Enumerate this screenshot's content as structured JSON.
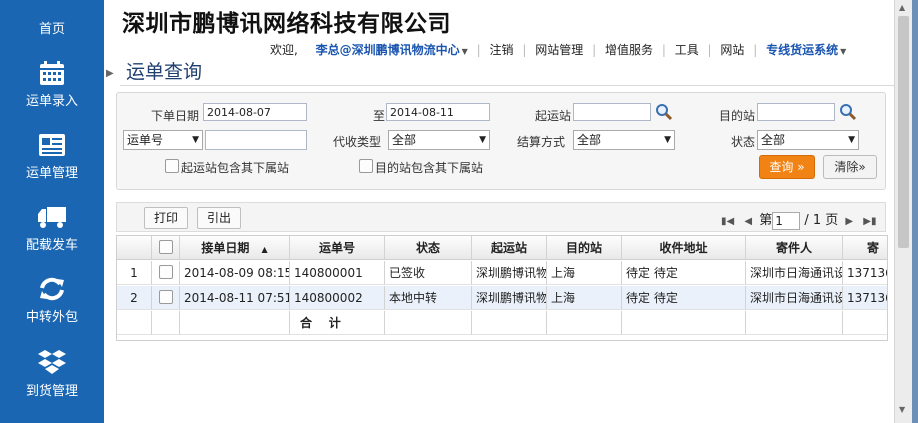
{
  "sidebar": {
    "items": [
      {
        "label": "首页",
        "icon": "home"
      },
      {
        "label": "运单录入",
        "icon": "calendar-icon"
      },
      {
        "label": "运单管理",
        "icon": "document-list-icon"
      },
      {
        "label": "配载发车",
        "icon": "truck-icon"
      },
      {
        "label": "中转外包",
        "icon": "refresh-icon"
      },
      {
        "label": "到货管理",
        "icon": "dropbox-icon"
      }
    ]
  },
  "header": {
    "company": "深圳市鹏博讯网络科技有限公司",
    "welcome": "欢迎,",
    "user": "李总@深圳鹏博讯物流中心",
    "nav": [
      "注销",
      "网站管理",
      "增值服务",
      "工具",
      "网站"
    ],
    "system": "专线货运系统"
  },
  "page_title": "运单查询",
  "filters": {
    "order_date_label": "下单日期",
    "date_from": "2014-08-07",
    "to_label": "至",
    "date_to": "2014-08-11",
    "origin_label": "起运站",
    "origin_value": "",
    "dest_label": "目的站",
    "dest_value": "",
    "waybill_type": "运单号",
    "waybill_value": "",
    "collect_type_label": "代收类型",
    "collect_type_value": "全部",
    "settle_label": "结算方式",
    "settle_value": "全部",
    "status_label": "状态",
    "status_value": "全部",
    "origin_sub_label": "起运站包含其下属站",
    "dest_sub_label": "目的站包含其下属站",
    "query_label": "查询 »",
    "clear_label": "清除»"
  },
  "toolbar": {
    "print_label": "打印",
    "export_label": "引出",
    "page_prefix": "第",
    "page_value": "1",
    "page_total": "/ 1 页"
  },
  "table": {
    "headers": [
      "",
      "",
      "接单日期",
      "运单号",
      "状态",
      "起运站",
      "目的站",
      "收件地址",
      "寄件人",
      "寄"
    ],
    "sort_indicator": "▲",
    "rows": [
      {
        "idx": "1",
        "date": "2014-08-09 08:15",
        "no": "140800001",
        "status": "已签收",
        "origin": "深圳鹏博讯物",
        "dest": "上海",
        "address": "待定 待定",
        "sender": "深圳市日海通讯设",
        "phone": "137136"
      },
      {
        "idx": "2",
        "date": "2014-08-11 07:51",
        "no": "140800002",
        "status": "本地中转",
        "origin": "深圳鹏博讯物",
        "dest": "上海",
        "address": "待定 待定",
        "sender": "深圳市日海通讯设",
        "phone": "137136"
      }
    ],
    "total_label": "合    计"
  },
  "colors": {
    "sidebar": "#1a66b3",
    "title": "#1f3f6f",
    "accent_button": "#f18314",
    "link": "#1a55b0"
  }
}
